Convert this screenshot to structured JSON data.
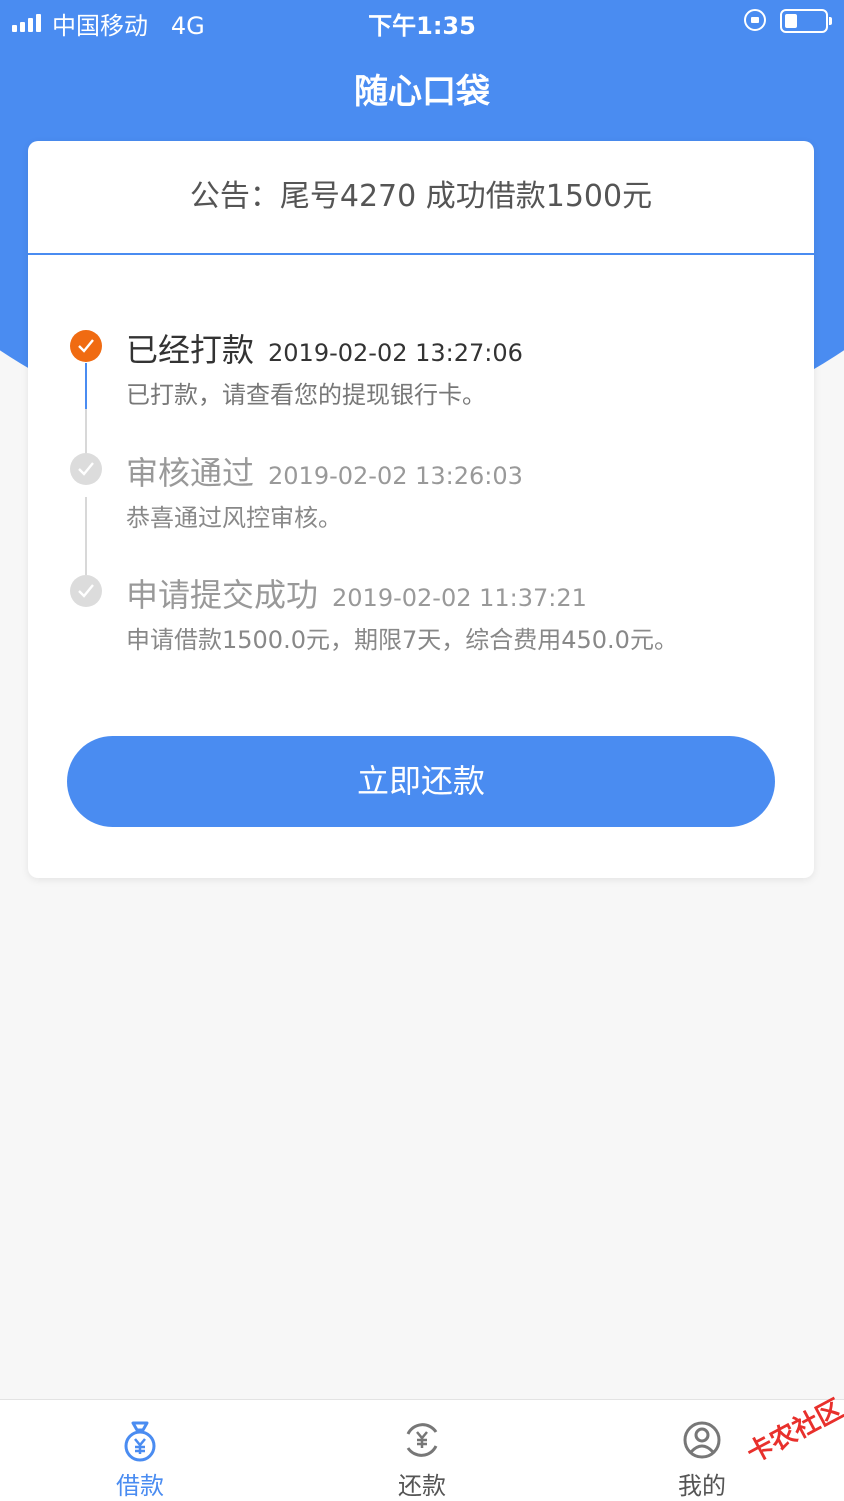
{
  "status_bar": {
    "carrier": "中国移动   4G",
    "time": "下午1:35"
  },
  "header": {
    "title": "随心口袋"
  },
  "notice": {
    "text": "公告：尾号4270 成功借款1500元"
  },
  "timeline": [
    {
      "title": "已经打款",
      "timestamp": "2019-02-02 13:27:06",
      "desc": "已打款，请查看您的提现银行卡。",
      "active": true
    },
    {
      "title": "审核通过",
      "timestamp": "2019-02-02 13:26:03",
      "desc": "恭喜通过风控审核。",
      "active": false
    },
    {
      "title": "申请提交成功",
      "timestamp": "2019-02-02 11:37:21",
      "desc": "申请借款1500.0元，期限7天，综合费用450.0元。",
      "active": false
    }
  ],
  "action": {
    "repay_label": "立即还款"
  },
  "tabbar": [
    {
      "label": "借款",
      "icon": "money-bag-icon",
      "active": true
    },
    {
      "label": "还款",
      "icon": "yuan-cycle-icon",
      "active": false
    },
    {
      "label": "我的",
      "icon": "user-icon",
      "active": false
    }
  ],
  "watermark": {
    "text": "卡农社区"
  },
  "colors": {
    "primary": "#4a8cf1",
    "active_step": "#f06b12",
    "inactive": "#c9c9c9",
    "active_text": "#333333",
    "inactive_text": "#999999"
  }
}
